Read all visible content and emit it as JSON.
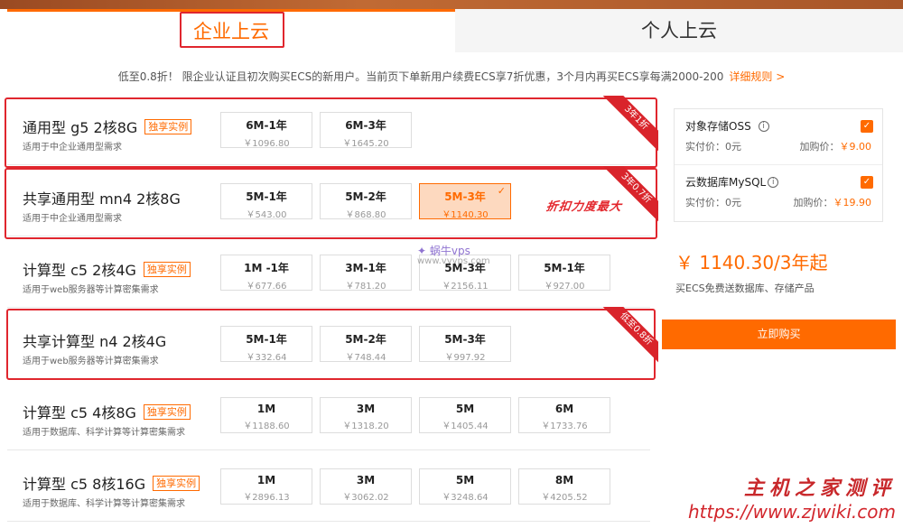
{
  "tabs": [
    {
      "label": "企业上云"
    },
    {
      "label": "个人上云"
    }
  ],
  "promo": {
    "text": "低至0.8折！ 限企业认证且初次购买ECS的新用户。当前页下单新用户续费ECS享7折优惠，3个月内再买ECS享每满2000-200",
    "link": "详细规则 >"
  },
  "products": [
    {
      "name": "通用型 g5 2核8G",
      "tag": "独享实例",
      "desc": "适用于中企业通用型需求",
      "options": [
        {
          "term": "6M-1年",
          "price": "￥1096.80"
        },
        {
          "term": "6M-3年",
          "price": "￥1645.20"
        }
      ],
      "ribbon": "3年1折"
    },
    {
      "name": "共享通用型 mn4 2核8G",
      "tag": "",
      "desc": "适用于中企业通用型需求",
      "options": [
        {
          "term": "5M-1年",
          "price": "￥543.00"
        },
        {
          "term": "5M-2年",
          "price": "￥868.80"
        },
        {
          "term": "5M-3年",
          "price": "￥1140.30",
          "selected": true
        }
      ],
      "ribbon": "3年0.7折"
    },
    {
      "name": "计算型 c5 2核4G",
      "tag": "独享实例",
      "desc": "适用于web服务器等计算密集需求",
      "options": [
        {
          "term": "1M -1年",
          "price": "￥677.66"
        },
        {
          "term": "3M-1年",
          "price": "￥781.20"
        },
        {
          "term": "5M-3年",
          "price": "￥2156.11"
        },
        {
          "term": "5M-1年",
          "price": "￥927.00"
        }
      ],
      "ribbon": ""
    },
    {
      "name": "共享计算型 n4 2核4G",
      "tag": "",
      "desc": "适用于web服务器等计算密集需求",
      "options": [
        {
          "term": "5M-1年",
          "price": "￥332.64"
        },
        {
          "term": "5M-2年",
          "price": "￥748.44"
        },
        {
          "term": "5M-3年",
          "price": "￥997.92"
        }
      ],
      "ribbon": "低至0.8折"
    },
    {
      "name": "计算型 c5 4核8G",
      "tag": "独享实例",
      "desc": "适用于数据库、科学计算等计算密集需求",
      "options": [
        {
          "term": "1M",
          "price": "￥1188.60"
        },
        {
          "term": "3M",
          "price": "￥1318.20"
        },
        {
          "term": "5M",
          "price": "￥1405.44"
        },
        {
          "term": "6M",
          "price": "￥1733.76"
        }
      ],
      "ribbon": ""
    },
    {
      "name": "计算型 c5 8核16G",
      "tag": "独享实例",
      "desc": "适用于数据库、科学计算等计算密集需求",
      "options": [
        {
          "term": "1M",
          "price": "￥2896.13"
        },
        {
          "term": "3M",
          "price": "￥3062.02"
        },
        {
          "term": "5M",
          "price": "￥3248.64"
        },
        {
          "term": "8M",
          "price": "￥4205.52"
        }
      ],
      "ribbon": ""
    }
  ],
  "annotation": "折扣力度最大",
  "watermark_center": {
    "logo": "✦ 蜗牛vps",
    "url": "www.vvvps.com"
  },
  "addons": [
    {
      "name": "对象存储OSS",
      "actual": "实付价：0元",
      "extra_label": "加购价：",
      "extra_price": "￥9.00",
      "checked": true
    },
    {
      "name": "云数据库MySQL",
      "actual": "实付价：0元",
      "extra_label": "加购价：",
      "extra_price": "￥19.90",
      "checked": true
    }
  ],
  "summary": {
    "price": "￥ 1140.30/3年起",
    "note": "买ECS免费送数据库、存储产品"
  },
  "buy_button": "立即购买",
  "watermark_bottom": {
    "cn": "主机之家测评",
    "url": "https://www.zjwiki.com"
  },
  "colors": {
    "accent": "#ff6a00",
    "highlight": "#e0262e",
    "ribbon": "#d9242b"
  }
}
